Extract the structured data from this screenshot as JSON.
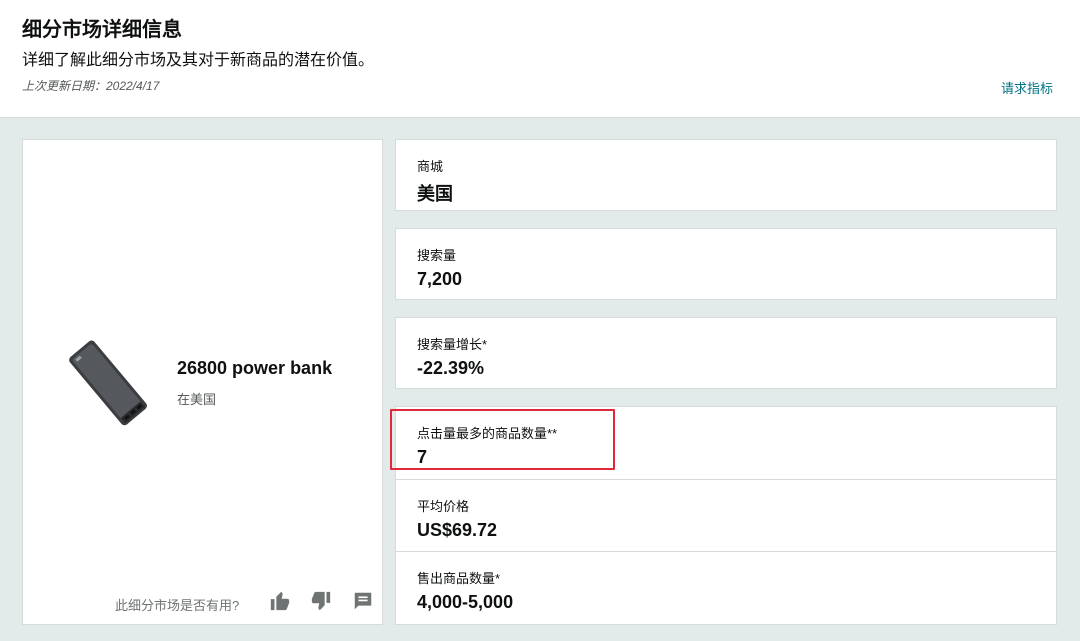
{
  "header": {
    "title": "细分市场详细信息",
    "subtitle": "详细了解此细分市场及其对于新商品的潜在价值。",
    "updated": "上次更新日期：2022/4/17",
    "request_metrics": "请求指标"
  },
  "product": {
    "name": "26800 power bank",
    "location": "在美国",
    "image_icon": "power-bank-image"
  },
  "feedback": {
    "question": "此细分市场是否有用?",
    "icons": [
      "thumbs-up-icon",
      "thumbs-down-icon",
      "comment-icon"
    ]
  },
  "metrics": [
    {
      "label": "商城",
      "value": "美国"
    },
    {
      "label": "搜索量",
      "value": "7,200"
    },
    {
      "label": "搜索量增长*",
      "value": "-22.39%"
    },
    {
      "label": "点击量最多的商品数量**",
      "value": "7"
    },
    {
      "label": "平均价格",
      "value": "US$69.72"
    },
    {
      "label": "售出商品数量*",
      "value": "4,000-5,000"
    }
  ],
  "colors": {
    "link": "#007185",
    "highlight": "#e0283a",
    "background": "#e2eaea"
  }
}
